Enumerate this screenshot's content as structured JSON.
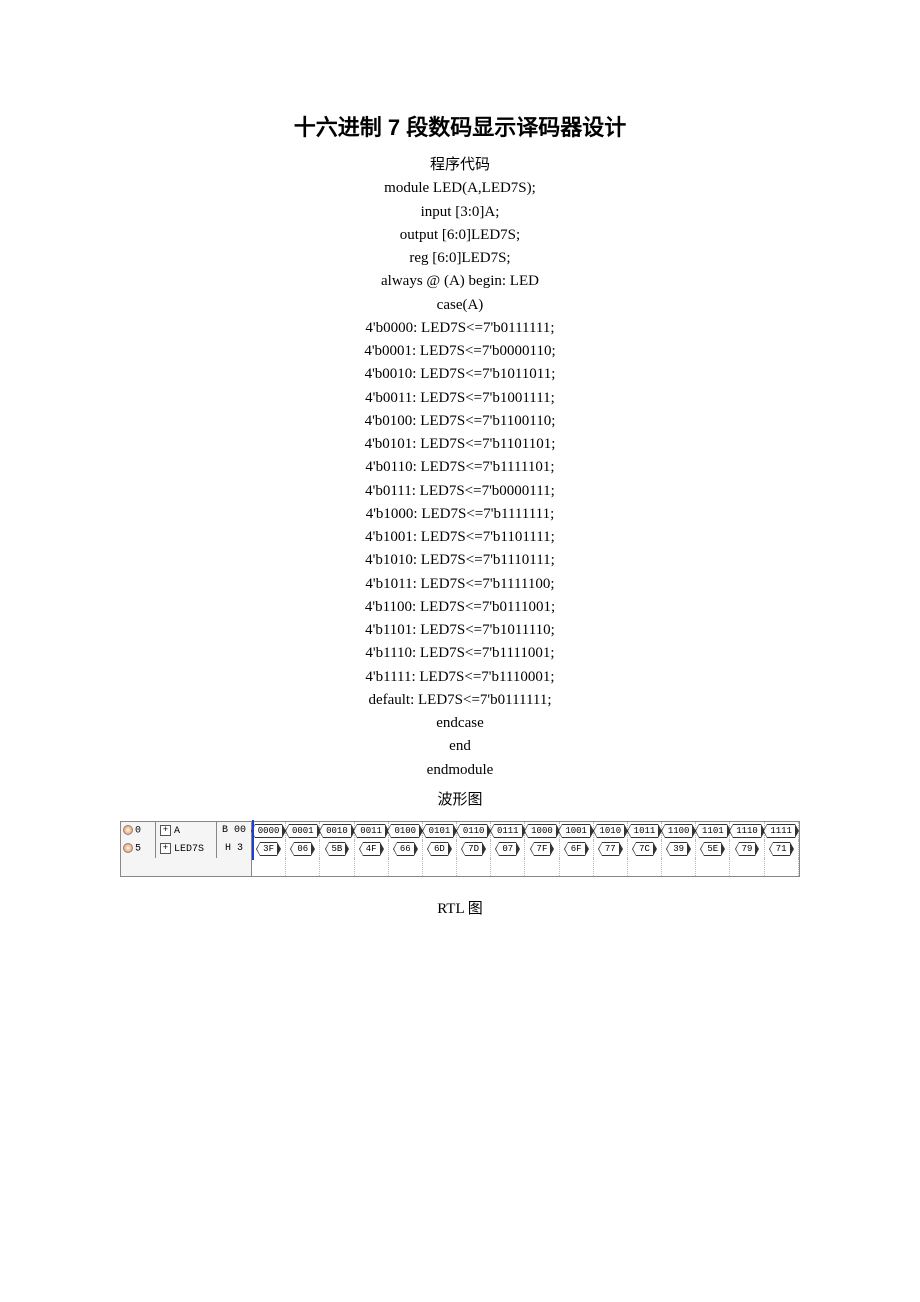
{
  "title": "十六进制 7 段数码显示译码器设计",
  "section_code_label": "程序代码",
  "code_lines": [
    "module LED(A,LED7S);",
    "input [3:0]A;",
    "output [6:0]LED7S;",
    "reg [6:0]LED7S;",
    "always @ (A) begin: LED",
    "case(A)",
    "4'b0000: LED7S<=7'b0111111;",
    "4'b0001: LED7S<=7'b0000110;",
    "4'b0010: LED7S<=7'b1011011;",
    "4'b0011: LED7S<=7'b1001111;",
    "4'b0100: LED7S<=7'b1100110;",
    "4'b0101: LED7S<=7'b1101101;",
    "4'b0110: LED7S<=7'b1111101;",
    "4'b0111: LED7S<=7'b0000111;",
    "4'b1000: LED7S<=7'b1111111;",
    "4'b1001: LED7S<=7'b1101111;",
    "4'b1010: LED7S<=7'b1110111;",
    "4'b1011: LED7S<=7'b1111100;",
    "4'b1100: LED7S<=7'b0111001;",
    "4'b1101: LED7S<=7'b1011110;",
    "4'b1110: LED7S<=7'b1111001;",
    "4'b1111: LED7S<=7'b1110001;",
    "default: LED7S<=7'b0111111;",
    "endcase",
    "end",
    "endmodule"
  ],
  "section_wave_label": "波形图",
  "section_rtl_label": "RTL 图",
  "chart_data": {
    "type": "table",
    "title": "Simulation waveform",
    "signals": [
      {
        "pin": "0",
        "name": "A",
        "init": "B 00",
        "values": [
          "0000",
          "0001",
          "0010",
          "0011",
          "0100",
          "0101",
          "0110",
          "0111",
          "1000",
          "1001",
          "1010",
          "1011",
          "1100",
          "1101",
          "1110",
          "1111"
        ]
      },
      {
        "pin": "5",
        "name": "LED7S",
        "init": "H 3",
        "values": [
          "3F",
          "06",
          "5B",
          "4F",
          "66",
          "6D",
          "7D",
          "07",
          "7F",
          "6F",
          "77",
          "7C",
          "39",
          "5E",
          "79",
          "71"
        ]
      }
    ]
  }
}
